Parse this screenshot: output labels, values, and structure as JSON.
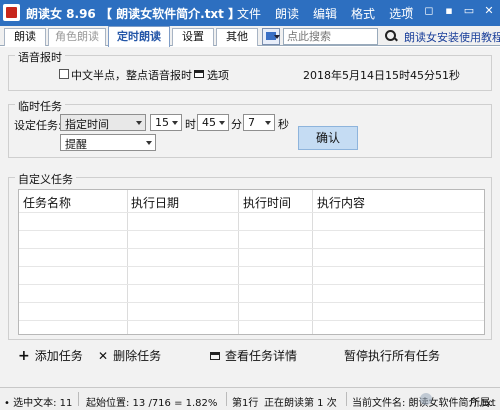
{
  "titlebar": {
    "title": "朗读女 8.96 【 朗读女软件简介.txt 】",
    "menu": [
      "文件",
      "朗读",
      "编辑",
      "格式",
      "选项"
    ],
    "controls": [
      "☼",
      "◻",
      "▪",
      "▭",
      "✕"
    ]
  },
  "tabs": [
    {
      "label": "朗读",
      "state": "normal"
    },
    {
      "label": "角色朗读",
      "state": "disabled"
    },
    {
      "label": "定时朗读",
      "state": "active"
    },
    {
      "label": "设置",
      "state": "normal"
    },
    {
      "label": "其他",
      "state": "normal"
    }
  ],
  "search": {
    "placeholder": "点此搜索"
  },
  "help_link": "朗读女安装使用教程",
  "voice_report": {
    "group_label": "语音报时",
    "checkbox_label": "中文半点，整点语音报时",
    "options_label": "选项",
    "datetime": "2018年5月14日15时45分51秒"
  },
  "temp_task": {
    "group_label": "临时任务",
    "set_task_label": "设定任务:",
    "mode_value": "指定时间",
    "hour_value": "15",
    "hour_unit": "时",
    "minute_value": "45",
    "minute_unit": "分",
    "second_value": "7",
    "second_unit": "秒",
    "action_value": "提醒",
    "confirm_label": "确认"
  },
  "custom_task": {
    "group_label": "自定义任务",
    "columns": [
      "任务名称",
      "执行日期",
      "执行时间",
      "执行内容"
    ],
    "rows": []
  },
  "actions": {
    "add": "添加任务",
    "delete": "删除任务",
    "details": "查看任务详情",
    "pause_all": "暂停执行所有任务"
  },
  "statusbar": {
    "selected": "• 选中文本: 11",
    "position": "起始位置: 13 /716 = 1.82%",
    "line": "第1行",
    "reading": "正在朗读第 1 次",
    "current_file": "当前文件名: 朗读女软件简介.txt",
    "tail": "所属:"
  },
  "colors": {
    "titlebar": "#2d6fc0",
    "active_tab_text": "#2456a8",
    "confirm_button": "#c5dcf3",
    "help_link": "#1a3f9a"
  }
}
